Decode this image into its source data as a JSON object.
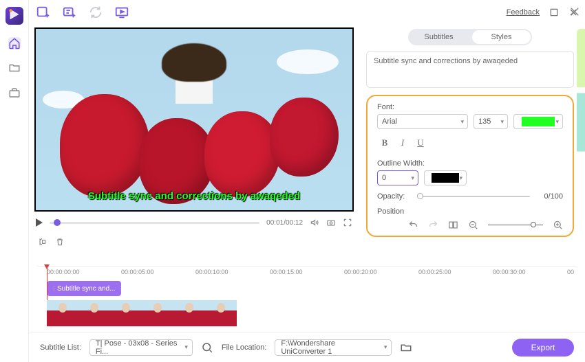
{
  "topbar": {
    "feedback": "Feedback"
  },
  "tabs": {
    "subtitles": "Subtitles",
    "styles": "Styles"
  },
  "subtitle": {
    "text": "Subtitle sync and corrections by awaqeded",
    "overlay": "Subtitle sync and corrections by awaqeded"
  },
  "font": {
    "label": "Font:",
    "family": "Arial",
    "size": "135",
    "color": "#22ff22"
  },
  "outline": {
    "label": "Outline Width:",
    "width": "0",
    "color": "#000000"
  },
  "opacity": {
    "label": "Opacity:",
    "value": "0/100"
  },
  "position": {
    "label": "Position"
  },
  "player": {
    "time": "00:01/00:12"
  },
  "timeline": {
    "ticks": [
      "00:00:00:00",
      "00:00:05:00",
      "00:00:10:00",
      "00:00:15:00",
      "00:00:20:00",
      "00:00:25:00",
      "00:00:30:00",
      "00"
    ],
    "clip": "Subtitle sync and..."
  },
  "footer": {
    "subtitle_list_label": "Subtitle List:",
    "subtitle_list_value": "T| Pose - 03x08 - Series Fi...",
    "file_location_label": "File Location:",
    "file_location_value": "F:\\Wondershare UniConverter 1",
    "export": "Export"
  }
}
